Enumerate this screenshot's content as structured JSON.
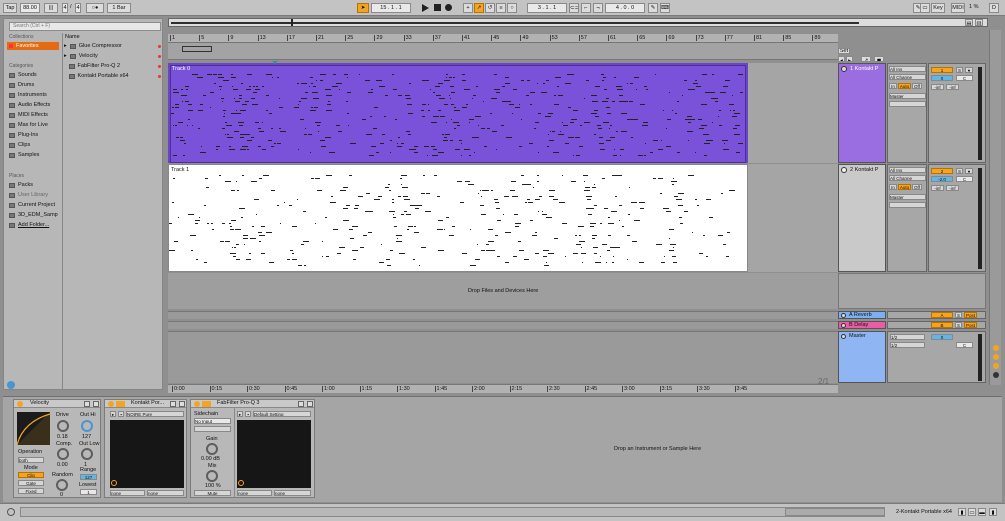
{
  "toolbar": {
    "tap": "Tap",
    "tempo": "88.00",
    "sig_num": "4",
    "sig_den": "4",
    "metro": "○●",
    "quant": "1 Bar",
    "pos": "15 . 1 . 1",
    "loop_start": "3 . 1 . 1",
    "loop_len": "4 . 0 . 0",
    "key": "Key",
    "midi": "MIDI",
    "cpu": "1 %",
    "d": "D"
  },
  "browser": {
    "search_placeholder": "Search (Ctrl + F)",
    "collections_header": "Collections",
    "favorites": "Favorites",
    "categories_header": "Categories",
    "categories": [
      "Sounds",
      "Drums",
      "Instruments",
      "Audio Effects",
      "MIDI Effects",
      "Max for Live",
      "Plug-Ins",
      "Clips",
      "Samples"
    ],
    "places_header": "Places",
    "places": [
      "Packs",
      "User Library",
      "Current Project",
      "3D_EDM_Samp",
      "Add Folder..."
    ],
    "col_name": "Name",
    "items": [
      "Glue Compressor",
      "Velocity",
      "FabFilter Pro-Q 2",
      "Kontakt Portable x64"
    ]
  },
  "ruler": {
    "bars": [
      "1",
      "5",
      "9",
      "13",
      "17",
      "21",
      "25",
      "29",
      "33",
      "37",
      "41",
      "45",
      "49",
      "53",
      "57",
      "61",
      "65",
      "69",
      "73",
      "77",
      "81",
      "85",
      "89"
    ]
  },
  "timeline": {
    "labels": [
      "0:00",
      "0:15",
      "0:30",
      "0:45",
      "1:00",
      "1:15",
      "1:30",
      "1:45",
      "2:00",
      "2:15",
      "2:30",
      "2:45",
      "3:00",
      "3:15",
      "3:30",
      "3:45"
    ]
  },
  "tracks": [
    {
      "clip": "Track 0",
      "name": "1 Kontakt P",
      "input": "All Ins",
      "channel": "All Channe",
      "mon_in": "In",
      "mon_auto": "Auto",
      "mon_off": "Off",
      "out": "Master",
      "num": "1",
      "vol": "0",
      "pan": "C",
      "s": "S",
      "v1": "-inf",
      "v2": "-inf"
    },
    {
      "clip": "Track 1",
      "name": "2 Kontakt P",
      "input": "All Ins",
      "channel": "All Channe",
      "mon_in": "In",
      "mon_auto": "Auto",
      "mon_off": "Off",
      "out": "Master",
      "num": "2",
      "vol": "-2.0",
      "pan": "C",
      "s": "S",
      "v1": "-inf",
      "v2": "-inf"
    }
  ],
  "returns": [
    {
      "name": "A Reverb",
      "letter": "A",
      "s": "S",
      "post": "Post"
    },
    {
      "name": "B Delay",
      "letter": "B",
      "s": "S",
      "post": "Post"
    }
  ],
  "master": {
    "name": "Master",
    "ratio1": "1/2",
    "ratio2": "1/2",
    "vol": "0",
    "pan": "C"
  },
  "set": "Set",
  "drop_files": "Drop Files and Devices Here",
  "page": "2/1",
  "devices": {
    "velocity": {
      "title": "Velocity",
      "drive": "Drive",
      "drive_val": "0.18",
      "outhi": "Out Hi",
      "outhi_val": "127",
      "comp": "Comp.",
      "comp_val": "0.00",
      "outlow": "Out Low",
      "outlow_val": "1",
      "operation": "Operation",
      "op_val": "both",
      "mode": "Mode",
      "clip": "Clip",
      "gate": "Gate",
      "fixed": "Fixed",
      "random": "Random",
      "random_val": "0",
      "range": "Range",
      "range_val": "127",
      "lowest": "Lowest",
      "lowest_val": "1"
    },
    "kontakt": {
      "title": "Kontakt Por...",
      "preset": "NOIRE Pure",
      "none1": "none",
      "none2": "none"
    },
    "fabfilter": {
      "title": "FabFilter Pro-Q 3",
      "sidechain": "Sidechain",
      "input": "No Input",
      "gain": "Gain",
      "gain_val": "0.00 dB",
      "mix": "Mix",
      "mix_val": "100 %",
      "mute": "Mute",
      "preset": "Default Setting",
      "none1": "none",
      "none2": "none"
    },
    "drop_instrument": "Drop an Instrument or Sample Here"
  },
  "status": {
    "device": "2-Kontakt Portable x64"
  }
}
